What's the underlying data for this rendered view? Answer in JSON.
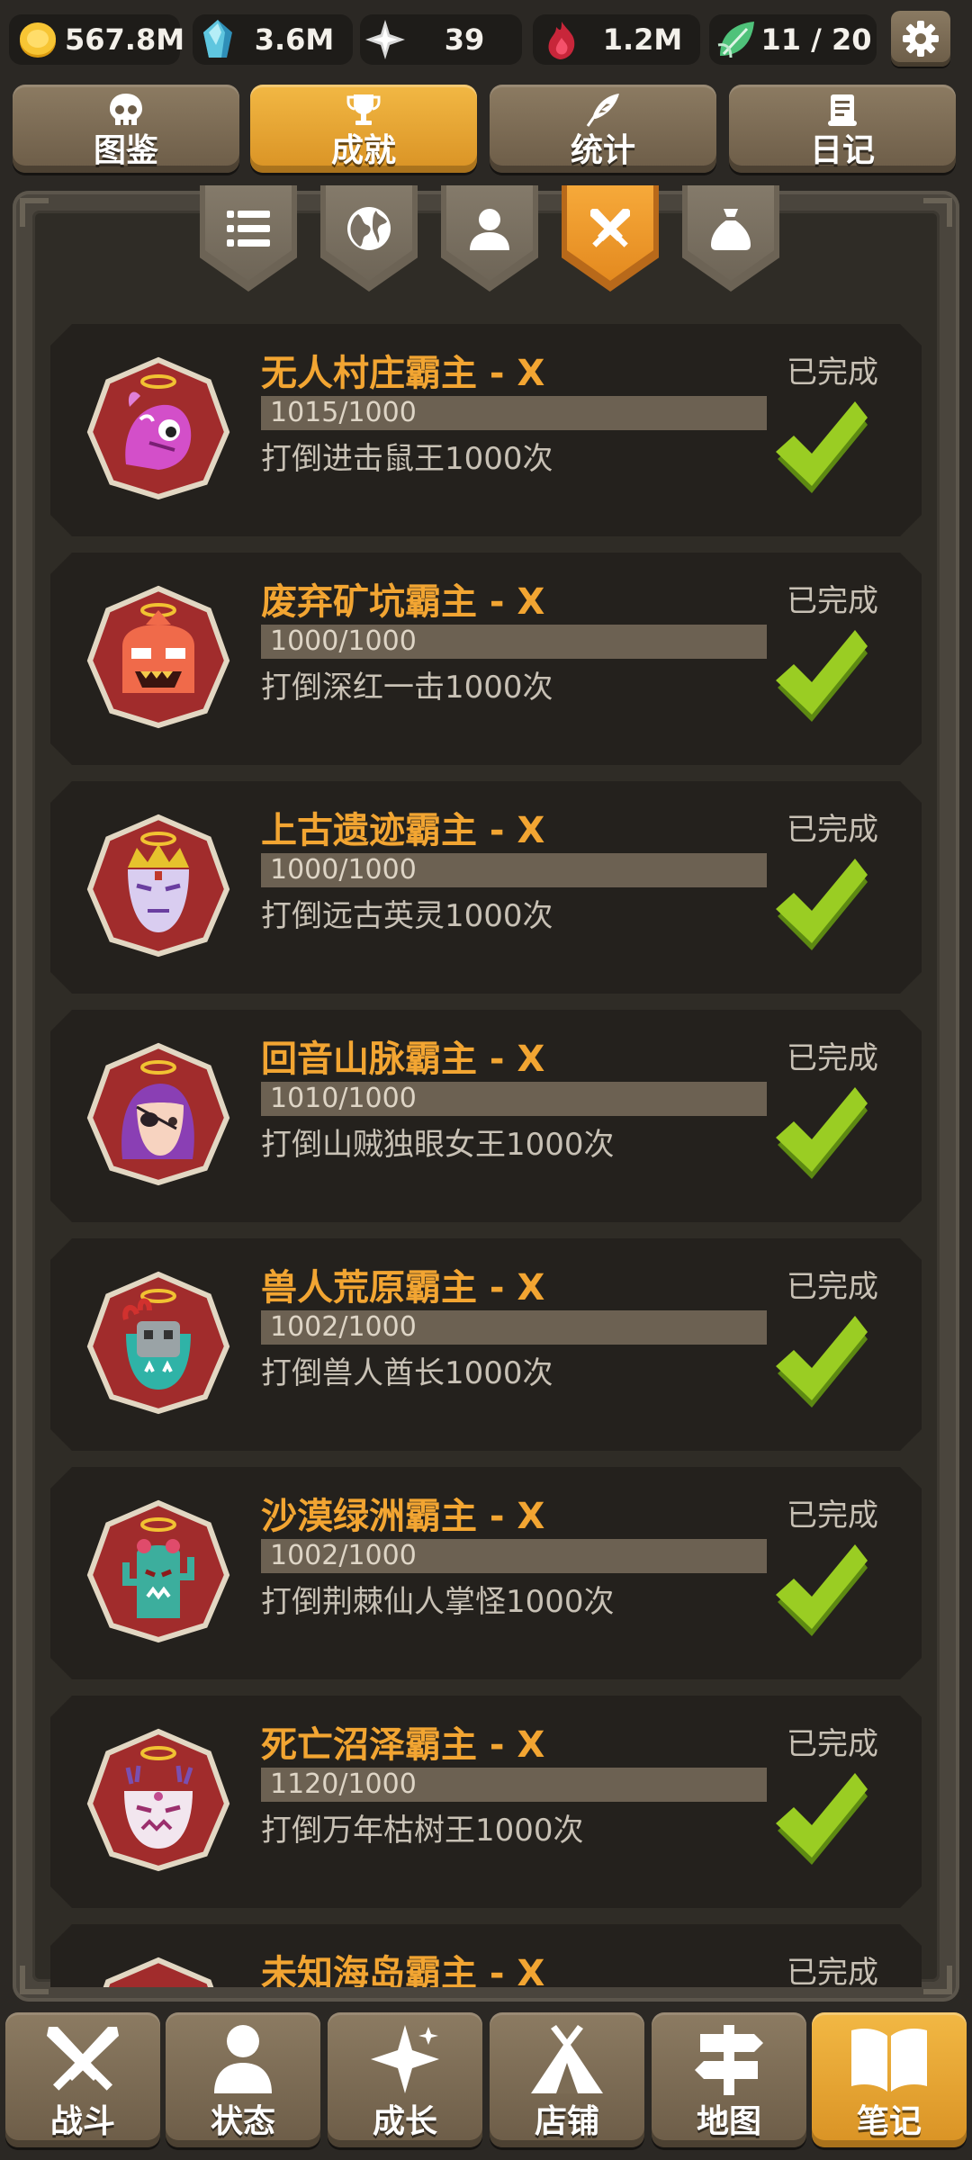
{
  "resources": {
    "gold": "567.8M",
    "crystal": "3.6M",
    "star": "39",
    "flame": "1.2M",
    "leaf": "11 / 20"
  },
  "main_tabs": [
    {
      "label": "图鉴",
      "icon": "skull-icon",
      "active": false
    },
    {
      "label": "成就",
      "icon": "trophy-icon",
      "active": true
    },
    {
      "label": "统计",
      "icon": "feather-icon",
      "active": false
    },
    {
      "label": "日记",
      "icon": "scroll-icon",
      "active": false
    }
  ],
  "sub_tabs": [
    {
      "icon": "list-icon",
      "active": false
    },
    {
      "icon": "globe-icon",
      "active": false
    },
    {
      "icon": "person-icon",
      "active": false
    },
    {
      "icon": "crossed-swords-icon",
      "active": true
    },
    {
      "icon": "money-bag-icon",
      "active": false
    }
  ],
  "achievements": [
    {
      "title": "无人村庄霸主 - X",
      "progress": "1015/1000",
      "desc": "打倒进击鼠王1000次",
      "status": "已完成"
    },
    {
      "title": "废弃矿坑霸主 - X",
      "progress": "1000/1000",
      "desc": "打倒深红一击1000次",
      "status": "已完成"
    },
    {
      "title": "上古遗迹霸主 - X",
      "progress": "1000/1000",
      "desc": "打倒远古英灵1000次",
      "status": "已完成"
    },
    {
      "title": "回音山脉霸主 - X",
      "progress": "1010/1000",
      "desc": "打倒山贼独眼女王1000次",
      "status": "已完成"
    },
    {
      "title": "兽人荒原霸主 - X",
      "progress": "1002/1000",
      "desc": "打倒兽人酋长1000次",
      "status": "已完成"
    },
    {
      "title": "沙漠绿洲霸主 - X",
      "progress": "1002/1000",
      "desc": "打倒荆棘仙人掌怪1000次",
      "status": "已完成"
    },
    {
      "title": "死亡沼泽霸主 - X",
      "progress": "1120/1000",
      "desc": "打倒万年枯树王1000次",
      "status": "已完成"
    },
    {
      "title": "未知海岛霸主 - X",
      "progress": "",
      "desc": "",
      "status": "已完成"
    }
  ],
  "bottom_nav": [
    {
      "label": "战斗",
      "icon": "swords-icon",
      "active": false
    },
    {
      "label": "状态",
      "icon": "person-icon",
      "active": false
    },
    {
      "label": "成长",
      "icon": "sparkle-icon",
      "active": false
    },
    {
      "label": "店铺",
      "icon": "tent-icon",
      "active": false
    },
    {
      "label": "地图",
      "icon": "signpost-icon",
      "active": false
    },
    {
      "label": "笔记",
      "icon": "book-icon",
      "active": true
    }
  ],
  "colors": {
    "accent": "#f2a532",
    "active_tab": "#e9a433",
    "tab": "#7c6c55",
    "check": "#8cc21e",
    "card_bg": "#24211d"
  }
}
